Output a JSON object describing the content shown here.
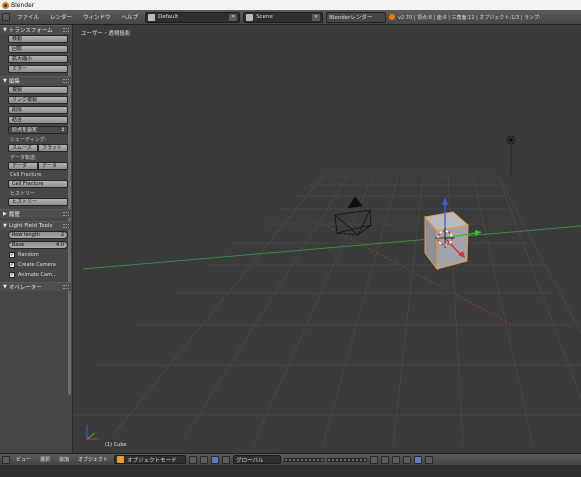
{
  "window": {
    "title": "Blender"
  },
  "top_header": {
    "menus": [
      "ファイル",
      "レンダー",
      "ウィンドウ",
      "ヘルプ"
    ],
    "layout_name": "Default",
    "scene_name": "Scene",
    "render_engine": "Blenderレンダー",
    "stats": "v2.70 | 頂点:8 | 面:6 | 三角面:12 | オブジェクト:1/3 | ランプ:"
  },
  "tool_shelf": {
    "transform": {
      "header": "トランスフォーム",
      "buttons": [
        "移動",
        "回転",
        "拡大縮小",
        "ミラー"
      ]
    },
    "edit": {
      "header": "編集",
      "buttons": [
        "複製",
        "リンク複製",
        "削除",
        "結合"
      ],
      "origin_select": "原点を設定",
      "shading_label": "シェーディング:",
      "shading_buttons": [
        "スムーズ",
        "フラット"
      ],
      "data_transfer_label": "データ転送:",
      "data_buttons": [
        "データ",
        "データ"
      ],
      "cell_fracture_label": "Cell Fracture",
      "cell_fracture_button": "Cell Fracture",
      "history_label": "ヒストリー",
      "history_button": "ヒストリー"
    },
    "history": {
      "header": "履歴"
    },
    "light_field": {
      "header": "Light Field Tools",
      "row_x_label": "Row length",
      "row_x_value": "2",
      "spacing_label": "Base",
      "spacing_value": "4.0",
      "checks": [
        "Random",
        "Create Camera",
        "Animate Cam..."
      ]
    },
    "operator": {
      "header": "オペレーター"
    }
  },
  "viewport": {
    "view_label": "ユーザー・透視投影",
    "object_label": "(1) Cube"
  },
  "bottom_header": {
    "menus": [
      "ビュー",
      "選択",
      "追加",
      "オブジェクト"
    ],
    "mode": "オブジェクトモード",
    "orientation": "グローバル"
  }
}
